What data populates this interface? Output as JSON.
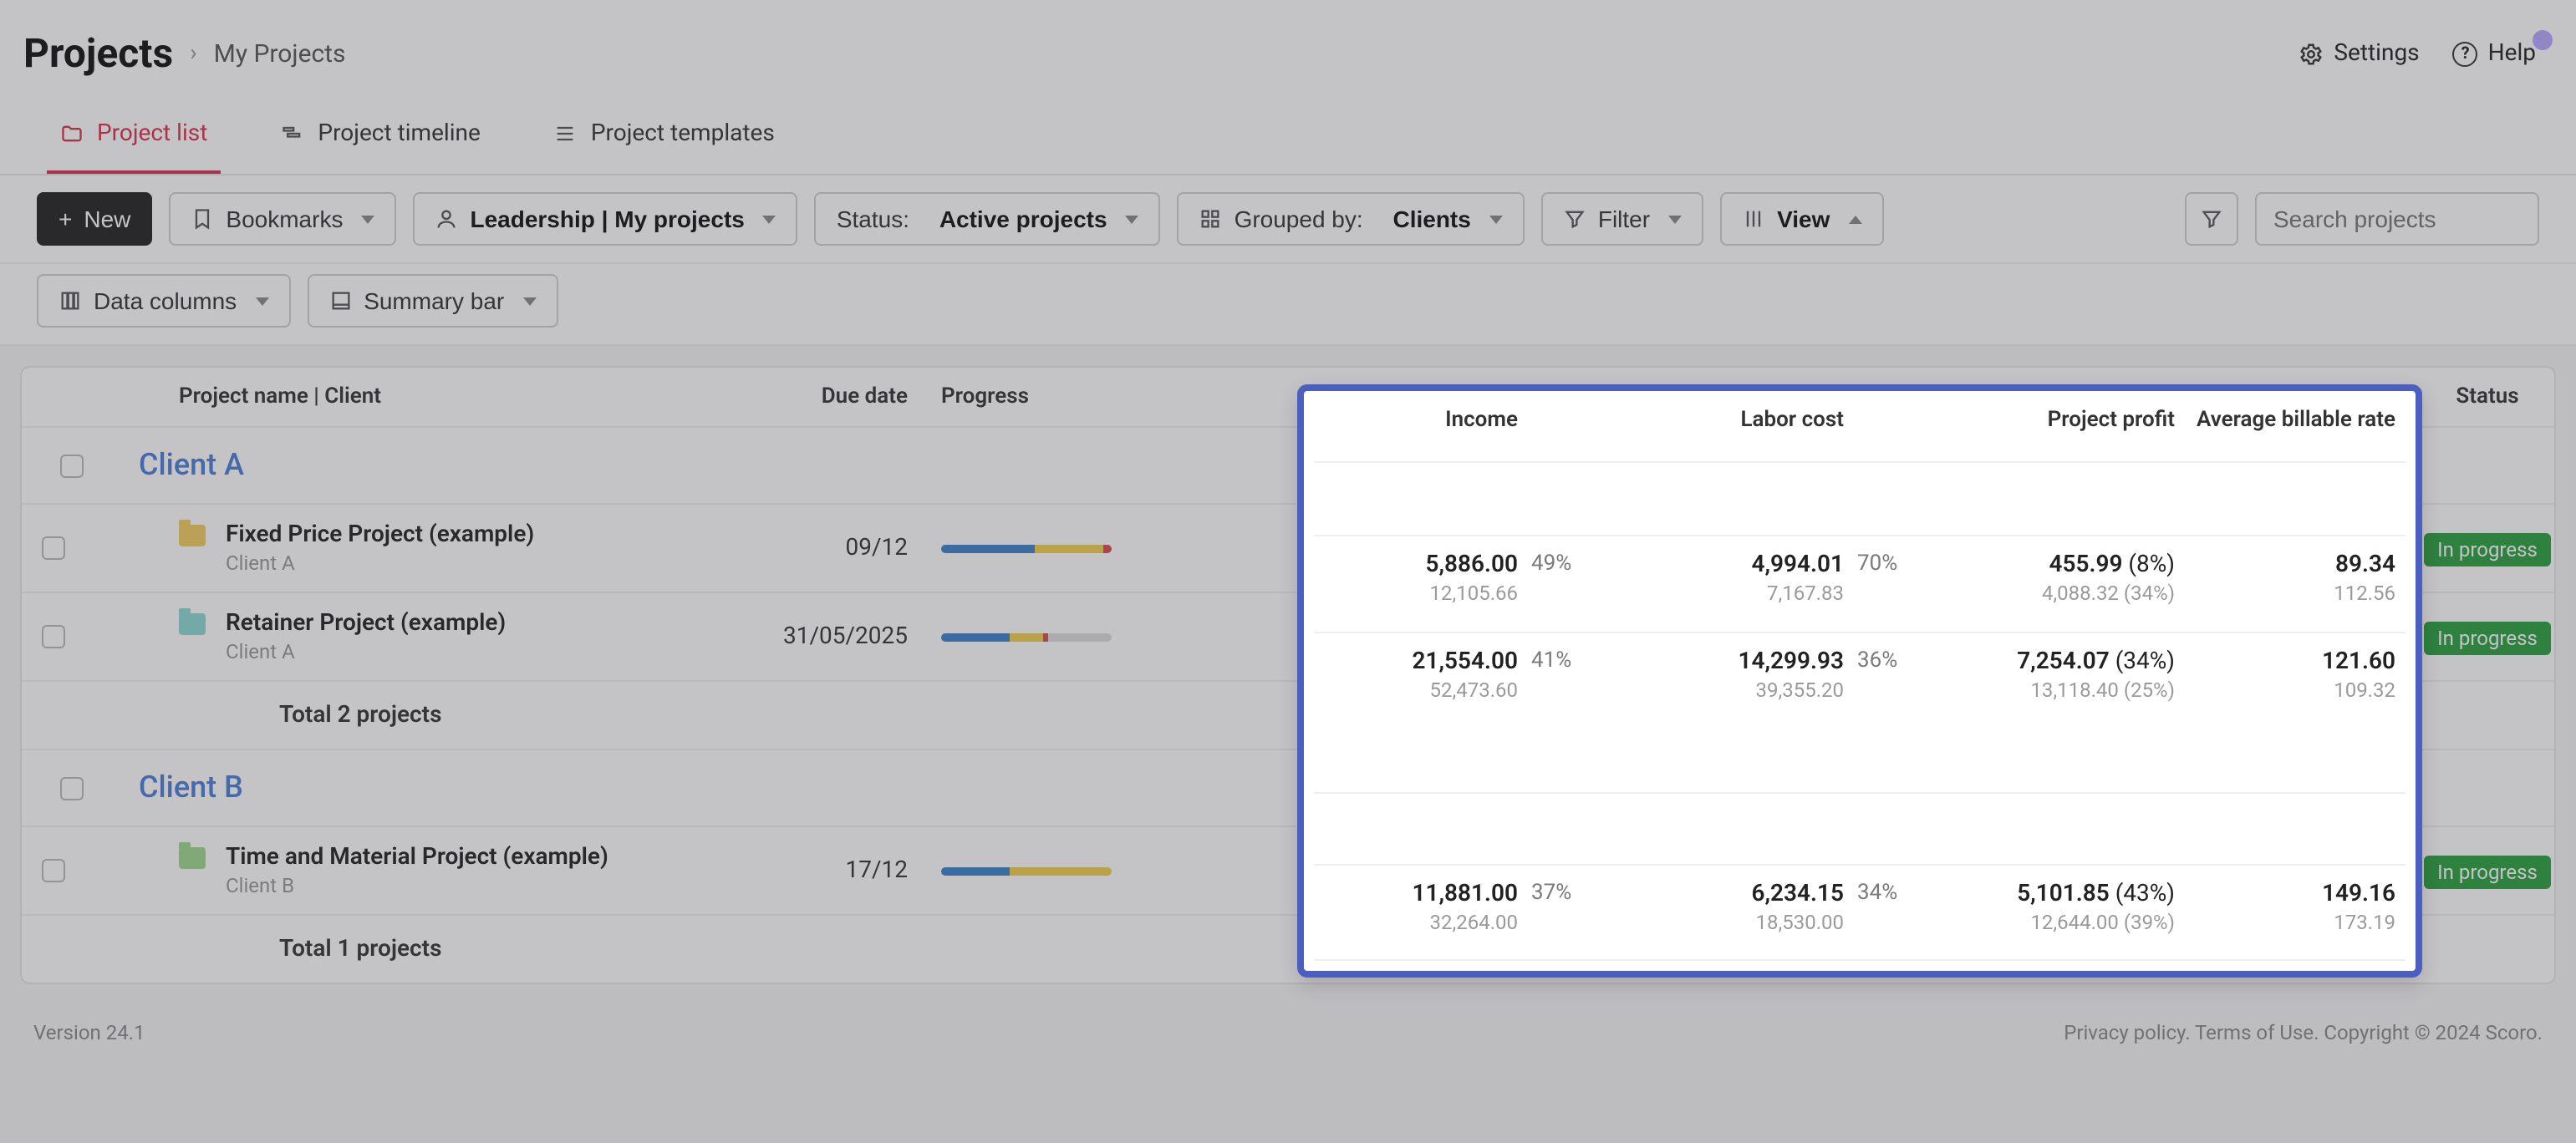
{
  "header": {
    "title": "Projects",
    "breadcrumb": "My Projects",
    "settings": "Settings",
    "help": "Help"
  },
  "tabs": [
    {
      "id": "list",
      "label": "Project list",
      "active": true
    },
    {
      "id": "timeline",
      "label": "Project timeline",
      "active": false
    },
    {
      "id": "templates",
      "label": "Project templates",
      "active": false
    }
  ],
  "toolbar": {
    "new_label": "New",
    "bookmarks": "Bookmarks",
    "scope_label": "Leadership | My projects",
    "status_prefix": "Status:",
    "status_value": "Active projects",
    "grouped_prefix": "Grouped by:",
    "grouped_value": "Clients",
    "filter": "Filter",
    "view": "View",
    "search_placeholder": "Search projects",
    "data_columns": "Data columns",
    "summary_bar": "Summary bar"
  },
  "columns": {
    "name": "Project name | Client",
    "due": "Due date",
    "progress": "Progress",
    "income": "Income",
    "labor": "Labor cost",
    "profit": "Project profit",
    "rate": "Average billable rate",
    "status": "Status"
  },
  "groups": [
    {
      "client": "Client A",
      "projects": [
        {
          "name": "Fixed Price Project (example)",
          "client": "Client A",
          "folder": "yellow",
          "due": "09/12",
          "progress": {
            "blue": 55,
            "yellow": 40,
            "red": 5
          },
          "income": {
            "main": "5,886.00",
            "sub": "12,105.66",
            "pct": "49%"
          },
          "labor": {
            "main": "4,994.01",
            "sub": "7,167.83",
            "pct": "70%"
          },
          "profit": {
            "main": "455.99",
            "pct": "(8%)",
            "sub": "4,088.32 (34%)"
          },
          "rate": {
            "main": "89.34",
            "sub": "112.56"
          },
          "status": "In progress"
        },
        {
          "name": "Retainer Project (example)",
          "client": "Client A",
          "folder": "teal",
          "due": "31/05/2025",
          "progress": {
            "blue": 40,
            "yellow": 20,
            "red": 3,
            "gray": 37
          },
          "income": {
            "main": "21,554.00",
            "sub": "52,473.60",
            "pct": "41%"
          },
          "labor": {
            "main": "14,299.93",
            "sub": "39,355.20",
            "pct": "36%"
          },
          "profit": {
            "main": "7,254.07",
            "pct": "(34%)",
            "sub": "13,118.40 (25%)"
          },
          "rate": {
            "main": "121.60",
            "sub": "109.32"
          },
          "status": "In progress"
        }
      ],
      "total": "Total 2 projects"
    },
    {
      "client": "Client B",
      "projects": [
        {
          "name": "Time and Material Project (example)",
          "client": "Client B",
          "folder": "green",
          "due": "17/12",
          "progress": {
            "blue": 40,
            "yellow": 60
          },
          "income": {
            "main": "11,881.00",
            "sub": "32,264.00",
            "pct": "37%"
          },
          "labor": {
            "main": "6,234.15",
            "sub": "18,530.00",
            "pct": "34%"
          },
          "profit": {
            "main": "5,101.85",
            "pct": "(43%)",
            "sub": "12,644.00 (39%)"
          },
          "rate": {
            "main": "149.16",
            "sub": "173.19"
          },
          "status": "In progress"
        }
      ],
      "total": "Total 1 projects"
    }
  ],
  "footer": {
    "version": "Version 24.1",
    "privacy": "Privacy policy",
    "terms": "Terms of Use",
    "copyright": "Copyright © 2024 Scoro"
  }
}
